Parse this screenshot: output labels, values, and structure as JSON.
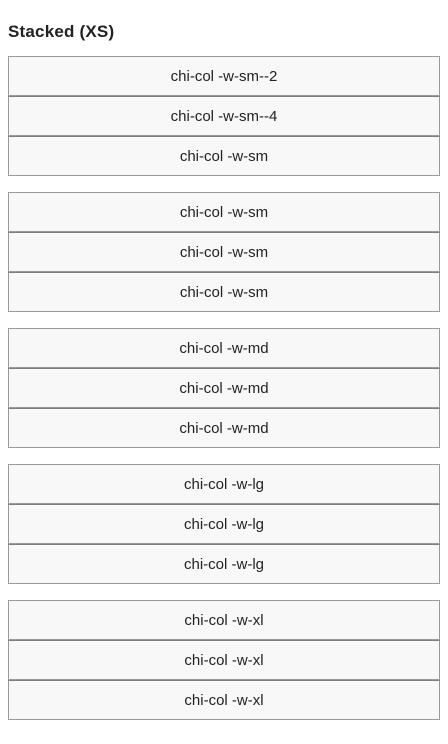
{
  "section": {
    "title": "Stacked (XS)"
  },
  "groups": [
    {
      "cells": [
        "chi-col -w-sm--2",
        "chi-col -w-sm--4",
        "chi-col -w-sm"
      ]
    },
    {
      "cells": [
        "chi-col -w-sm",
        "chi-col -w-sm",
        "chi-col -w-sm"
      ]
    },
    {
      "cells": [
        "chi-col -w-md",
        "chi-col -w-md",
        "chi-col -w-md"
      ]
    },
    {
      "cells": [
        "chi-col -w-lg",
        "chi-col -w-lg",
        "chi-col -w-lg"
      ]
    },
    {
      "cells": [
        "chi-col -w-xl",
        "chi-col -w-xl",
        "chi-col -w-xl"
      ]
    }
  ]
}
